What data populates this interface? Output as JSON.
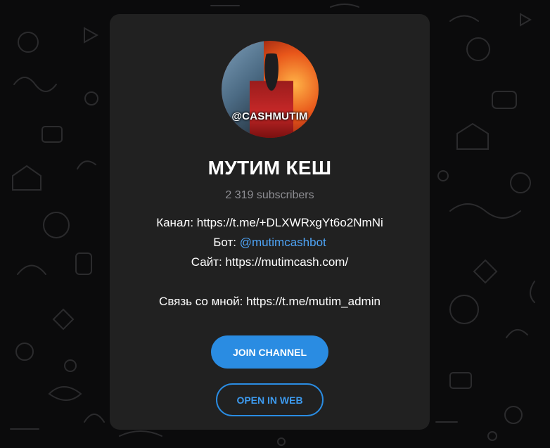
{
  "channel": {
    "avatar_text": "@CASHMUTIM",
    "title": "МУТИМ КЕШ",
    "subscribers": "2 319 subscribers",
    "description": {
      "line1": "Канал: https://t.me/+DLXWRxgYt6o2NmNi",
      "line2_prefix": "Бот: ",
      "line2_link": "@mutimcashbot",
      "line3": "Сайт: https://mutimcash.com/",
      "line4": "Связь со мной: https://t.me/mutim_admin"
    }
  },
  "buttons": {
    "join": "JOIN CHANNEL",
    "open_web": "OPEN IN WEB"
  },
  "colors": {
    "accent": "#2a8ce2",
    "link": "#4ea4f6",
    "card": "#212121",
    "background": "#0b0b0c"
  }
}
